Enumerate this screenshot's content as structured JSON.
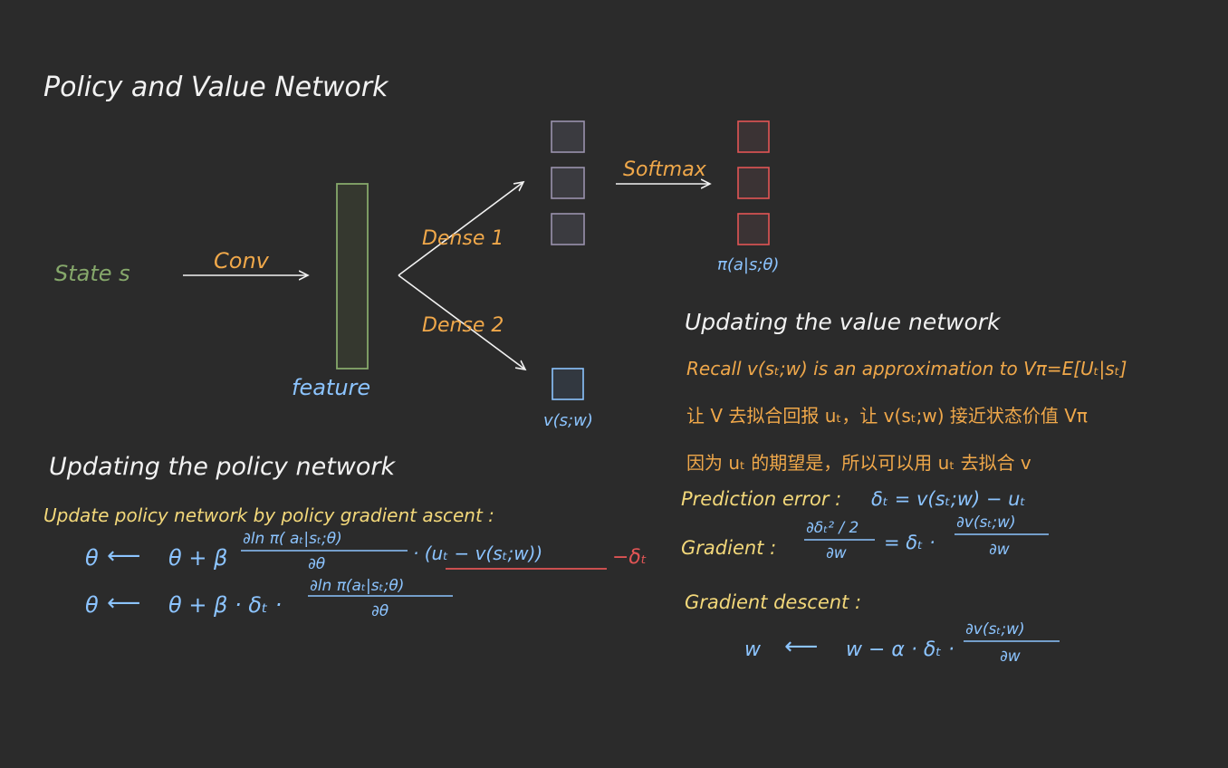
{
  "title": "Policy and Value Network",
  "colors": {
    "background": "#2b2b2b",
    "white": "#f2f2f2",
    "orange": "#f0a84a",
    "yellow": "#f3d87a",
    "blue": "#8cc4ff",
    "green": "#86a86b",
    "red": "#e25555",
    "gray_box": "#3b3b40",
    "purple_box_border": "#9a92ad"
  },
  "diagram": {
    "state_label": "State s",
    "conv_label": "Conv",
    "feature_label": "feature",
    "dense1_label": "Dense 1",
    "dense2_label": "Dense 2",
    "softmax_label": "Softmax",
    "policy_output_label": "π(a|s;θ)",
    "value_output_label": "v(s;w)"
  },
  "policy_section": {
    "heading": "Updating the policy network",
    "intro": "Update policy network by policy gradient ascent :",
    "eq1_lhs": "θ",
    "eq1_arrow": "⟵",
    "eq1_mid": "θ + β",
    "eq1_frac_num": "∂ln π( aₜ|sₜ;θ)",
    "eq1_frac_den": "∂θ",
    "eq1_tail": "· (uₜ − v(sₜ;w))",
    "eq1_note": "−δₜ",
    "eq2_lhs": "θ",
    "eq2_arrow": "⟵",
    "eq2_mid": "θ + β · δₜ ·",
    "eq2_frac_num": "∂ln π(aₜ|sₜ;θ)",
    "eq2_frac_den": "∂θ"
  },
  "value_section": {
    "heading": "Updating the value network",
    "recall": "Recall v(sₜ;w) is an approximation to Vπ=E[Uₜ|sₜ]",
    "cn_line1": "让 V 去拟合回报 uₜ，让 v(sₜ;w) 接近状态价值 Vπ",
    "cn_line2": "因为 uₜ 的期望是，所以可以用 uₜ 去拟合 v",
    "pred_error_label": "Prediction error :",
    "pred_error_expr": "δₜ = v(sₜ;w) − uₜ",
    "gradient_label": "Gradient :",
    "gradient_frac_num": "∂δₜ² / 2",
    "gradient_frac_den": "∂w",
    "gradient_mid": "= δₜ ·",
    "gradient_frac2_num": "∂v(sₜ;w)",
    "gradient_frac2_den": "∂w",
    "descent_label": "Gradient  descent :",
    "descent_lhs": "w",
    "descent_arrow": "⟵",
    "descent_mid": "w − α · δₜ ·",
    "descent_frac_num": "∂v(sₜ;w)",
    "descent_frac_den": "∂w"
  }
}
